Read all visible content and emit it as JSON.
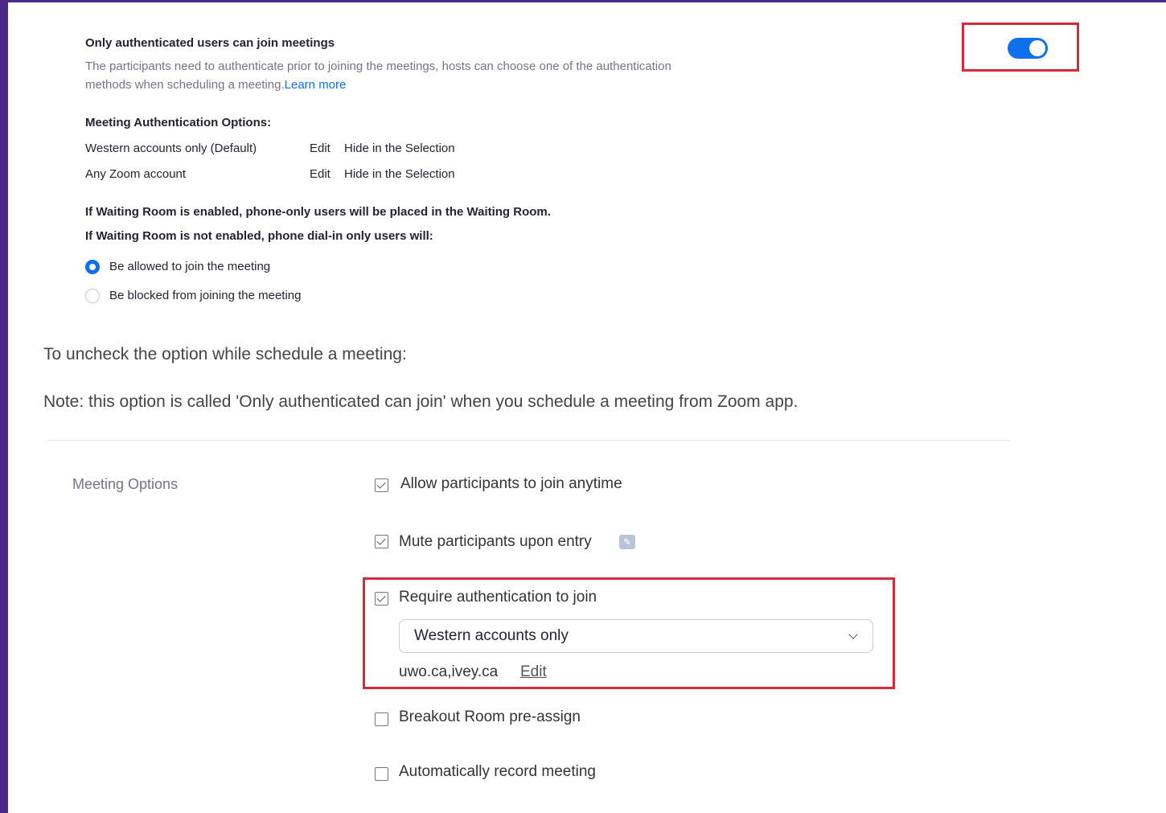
{
  "auth_setting": {
    "title": "Only authenticated users can join meetings",
    "description_line1": "The participants need to authenticate prior to joining the meetings, hosts can choose one of the authentication",
    "description_line2": "methods when scheduling a meeting.",
    "learn_more": "Learn more",
    "enabled": true
  },
  "auth_options": {
    "heading": "Meeting Authentication Options:",
    "items": [
      {
        "name": "Western accounts only (Default)",
        "edit": "Edit",
        "hide": "Hide in the Selection"
      },
      {
        "name": "Any Zoom account",
        "edit": "Edit",
        "hide": "Hide in the Selection"
      }
    ]
  },
  "waiting_room": {
    "line1": "If Waiting Room is enabled, phone-only users will be placed in the Waiting Room.",
    "line2": "If Waiting Room is not enabled, phone dial-in only users will:",
    "options": [
      {
        "label": "Be allowed to join the meeting",
        "selected": true
      },
      {
        "label": "Be blocked from joining the meeting",
        "selected": false
      }
    ]
  },
  "instructions": {
    "line1": "To uncheck the option while schedule a meeting:",
    "line2": "Note: this option is called 'Only authenticated can join' when you schedule a meeting from Zoom app."
  },
  "meeting_options": {
    "label": "Meeting Options",
    "allow_join_anytime": {
      "label": "Allow participants to join anytime",
      "checked": true
    },
    "mute_upon_entry": {
      "label": "Mute participants upon entry",
      "checked": true
    },
    "require_auth": {
      "label": "Require authentication to join",
      "checked": true,
      "selected_option": "Western accounts only",
      "domains": "uwo.ca,ivey.ca",
      "edit": "Edit"
    },
    "breakout_preassign": {
      "label": "Breakout Room pre-assign",
      "checked": false
    },
    "auto_record": {
      "label": "Automatically record meeting",
      "checked": false
    }
  },
  "colors": {
    "accent": "#0e71eb",
    "highlight": "#d62a3a",
    "border_left": "#4a2a86"
  }
}
